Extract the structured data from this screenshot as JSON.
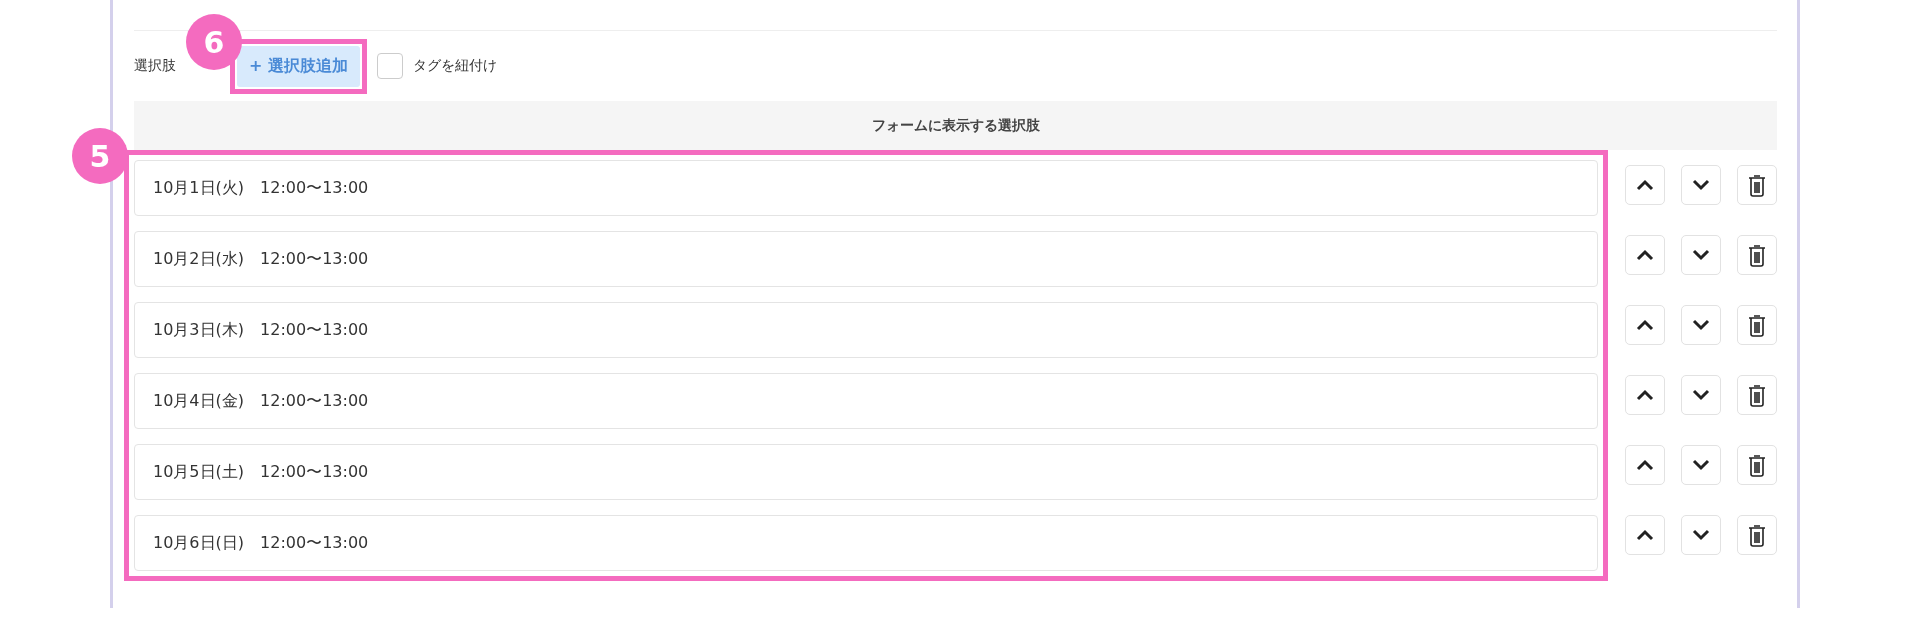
{
  "toolbar": {
    "label": "選択肢",
    "add_button": "+ 選択肢追加",
    "tag_checkbox": {
      "label": "タグを紐付け",
      "checked": false
    }
  },
  "list_header": "フォームに表示する選択肢",
  "options": [
    {
      "text": "10月1日(火)　12:00〜13:00"
    },
    {
      "text": "10月2日(水)　12:00〜13:00"
    },
    {
      "text": "10月3日(木)　12:00〜13:00"
    },
    {
      "text": "10月4日(金)　12:00〜13:00"
    },
    {
      "text": "10月5日(土)　12:00〜13:00"
    },
    {
      "text": "10月6日(日)　12:00〜13:00"
    }
  ],
  "callouts": [
    {
      "number": "5"
    },
    {
      "number": "6"
    }
  ]
}
